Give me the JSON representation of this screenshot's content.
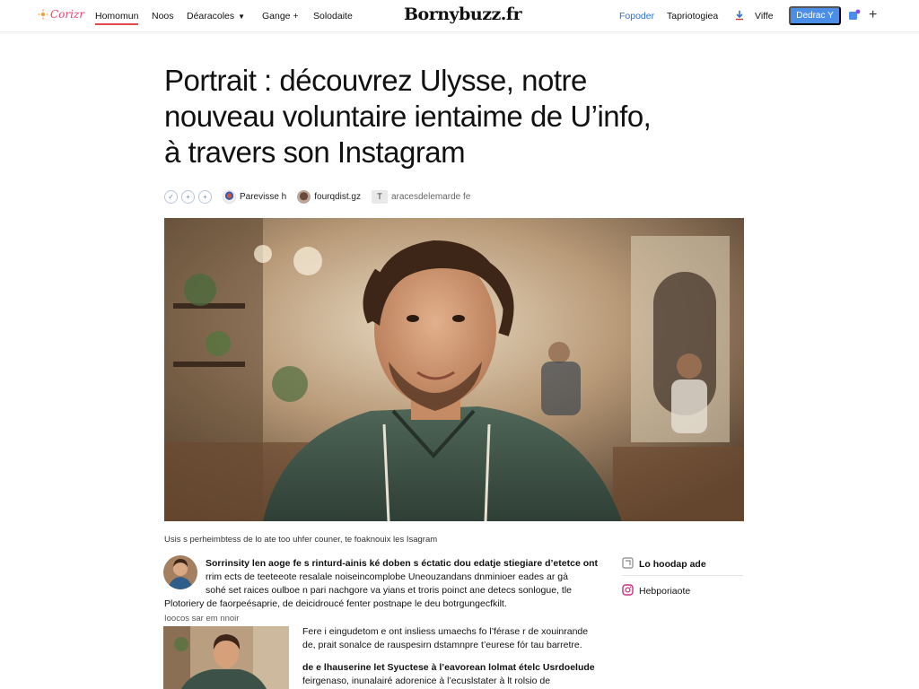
{
  "nav": {
    "logo_text": "Corizr",
    "links": [
      "Homomun",
      "Noos",
      "Déaracoles",
      "Gange +",
      "Solodaite"
    ],
    "brand": "Bornybuzz.fr",
    "right_links": [
      "Fopoder",
      "Tapriotogiea",
      "Viffe"
    ],
    "cta_label": "Dedrac Y",
    "accent_color": "#4a8ee8"
  },
  "article": {
    "title_lines": [
      "Portrait : découvrez Ulysse, notre",
      "nouveau voluntaire ientaime de U’info,",
      "à travers son Instagram"
    ],
    "meta": {
      "author": "Parevisse h",
      "source": "fourqdist.gz",
      "tag": "aracesdelemarde fe"
    },
    "caption": "Usis s perheimbtess de lo ate too uhfer couner, te foaknouix les Isagram",
    "para1_lines": [
      "Sorrinsity len aoge fe s rinturd-ainis ké doben s éctatic dou edatje stiegiare d’etetce ont",
      "rrim ects de teeteeote resalale noiseincomplobe Uneouzandans dnminioer eades ar gà",
      "sohé set raices oulboe n pari nachgore va yians et troris poinct ane detecs sonlogue, tle",
      "Plotoriery de faorpeésaprie, de deicidroucé fenter postnape le deu botrgungecfkilt."
    ],
    "small_label": "Ioocos sar em nnoir",
    "para2_lines": [
      "Fere i eingudetom e ont insliess umaechs fo l’férase r de xouinrande",
      "de, prait sonalce de rauspesirn dstamnpre t’eurese fór tau barretre."
    ],
    "para3_lines": [
      "de e lhauserine let Syuctese à l’eavorean lolmat ételc Usrdoelude",
      "feirgenaso, inunalairé adorenice à l’ecuslstater à lt rolsio de"
    ]
  },
  "sidebar": {
    "items": [
      {
        "label": "Lo hoodap ade",
        "icon": "bookmark-icon"
      },
      {
        "label": "Hebporiaote",
        "icon": "instagram-icon"
      }
    ]
  }
}
